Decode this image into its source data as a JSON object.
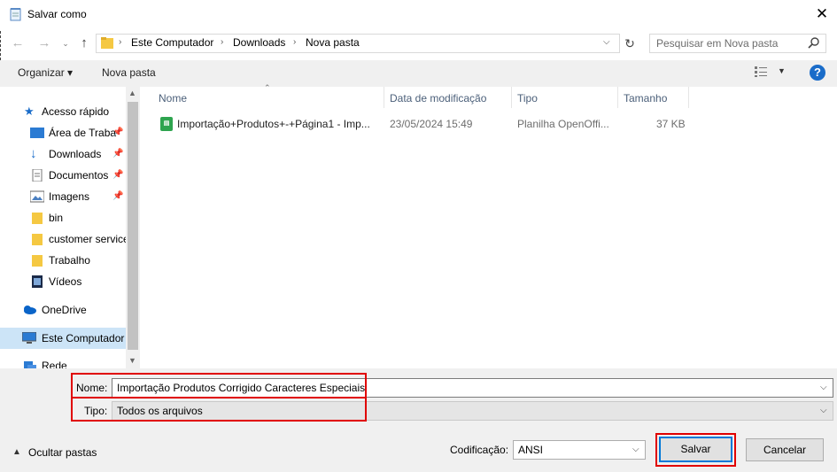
{
  "window": {
    "title": "Salvar como",
    "close_glyph": "✕"
  },
  "address": {
    "crumbs": [
      "Este Computador",
      "Downloads",
      "Nova pasta"
    ],
    "search_placeholder": "Pesquisar em Nova pasta"
  },
  "toolbar": {
    "organize_label": "Organizar ▾",
    "new_folder_label": "Nova pasta"
  },
  "nav": {
    "items": [
      {
        "label": "Acesso rápido",
        "icon": "star-icon",
        "pinned": false
      },
      {
        "label": "Área de Traba",
        "icon": "desktop-icon",
        "pinned": true
      },
      {
        "label": "Downloads",
        "icon": "download-icon",
        "pinned": true
      },
      {
        "label": "Documentos",
        "icon": "document-icon",
        "pinned": true
      },
      {
        "label": "Imagens",
        "icon": "image-icon",
        "pinned": true
      },
      {
        "label": "bin",
        "icon": "folder-icon",
        "pinned": false
      },
      {
        "label": "customer service",
        "icon": "folder-icon",
        "pinned": false
      },
      {
        "label": "Trabalho",
        "icon": "folder-icon",
        "pinned": false
      },
      {
        "label": "Vídeos",
        "icon": "video-icon",
        "pinned": false
      },
      {
        "label": "OneDrive",
        "icon": "cloud-icon",
        "pinned": false
      },
      {
        "label": "Este Computador",
        "icon": "computer-icon",
        "pinned": false
      },
      {
        "label": "Rede",
        "icon": "network-icon",
        "pinned": false
      }
    ]
  },
  "filelist": {
    "columns": [
      "Nome",
      "Data de modificação",
      "Tipo",
      "Tamanho"
    ],
    "rows": [
      {
        "name": "Importação+Produtos+-+Página1 - Imp...",
        "modified": "23/05/2024 15:49",
        "type": "Planilha OpenOffi...",
        "size": "37 KB"
      }
    ]
  },
  "form": {
    "name_label": "Nome:",
    "name_value": "Importação Produtos Corrigido Caracteres Especiais",
    "type_label": "Tipo:",
    "type_value": "Todos os arquivos",
    "encoding_label": "Codificação:",
    "encoding_value": "ANSI"
  },
  "footer": {
    "hide_folders_label": "Ocultar pastas",
    "save_label": "Salvar",
    "cancel_label": "Cancelar"
  },
  "colors": {
    "highlight_red": "#e00000",
    "accent_blue": "#0078d7",
    "selection": "#cce4f7"
  }
}
